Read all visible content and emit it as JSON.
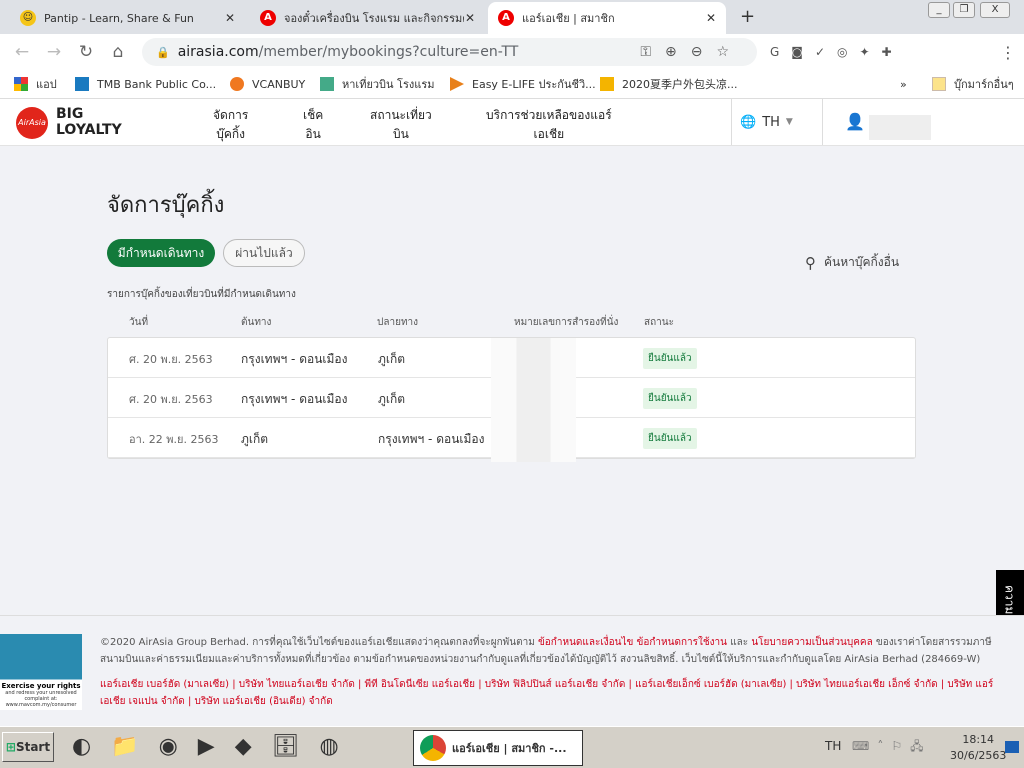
{
  "browser": {
    "tabs": [
      {
        "title": "Pantip - Learn, Share & Fun"
      },
      {
        "title": "จองตั๋วเครื่องบิน โรงแรม และกิจกรรมต่"
      },
      {
        "title": "แอร์เอเชีย | สมาชิก",
        "active": true
      }
    ],
    "url_host": "airasia.com",
    "url_path": "/member/mybookings?culture=en-TT",
    "bookmarks": [
      "แอป",
      "TMB Bank Public Co...",
      "VCANBUY",
      "หาเที่ยวบิน โรงแรม",
      "Easy E-LIFE ประกันชีวิ...",
      "2020夏季户外包头凉...",
      "บุ๊กมาร์กอื่นๆ"
    ]
  },
  "header": {
    "logo_brand": "AirAsia",
    "logo_line1": "BIG",
    "logo_line2": "LOYALTY",
    "menu": [
      [
        "จัดการ",
        "บุ๊คกิ้ง"
      ],
      [
        "เช็ค",
        "อิน"
      ],
      [
        "สถานะเที่ยว",
        "บิน"
      ],
      [
        "บริการช่วยเหลือของแอร์",
        "เอเชีย"
      ]
    ],
    "language": "TH"
  },
  "page": {
    "title": "จัดการบุ๊คกิ้ง",
    "tab_upcoming": "มีกำหนดเดินทาง",
    "tab_past": "ผ่านไปแล้ว",
    "search_other": "ค้นหาบุ๊คกิ้งอื่น",
    "list_caption": "รายการบุ๊คกิ้งของเที่ยวบินที่มีกำหนดเดินทาง",
    "columns": [
      "วันที่",
      "ต้นทาง",
      "ปลายทาง",
      "หมายเลขการสำรองที่นั่ง",
      "สถานะ"
    ],
    "rows": [
      {
        "date": "ศ. 20 พ.ย. 2563",
        "origin": "กรุงเทพฯ - ดอนเมือง",
        "destination": "ภูเก็ต",
        "status": "ยืนยันแล้ว"
      },
      {
        "date": "ศ. 20 พ.ย. 2563",
        "origin": "กรุงเทพฯ - ดอนเมือง",
        "destination": "ภูเก็ต",
        "status": "ยืนยันแล้ว"
      },
      {
        "date": "อา. 22 พ.ย. 2563",
        "origin": "ภูเก็ต",
        "destination": "กรุงเทพฯ - ดอนเมือง",
        "status": "ยืนยันแล้ว"
      }
    ],
    "accent": "#127a3b"
  },
  "feedback": "ความคิดเห็น",
  "footer": {
    "copy1": "©2020 AirAsia Group Berhad. การที่คุณใช้เว็บไซต์ของแอร์เอเชียแสดงว่าคุณตกลงที่จะผูกพันตาม ",
    "link1": "ข้อกำหนดและเงื่อนไข ข้อกำหนดการใช้งาน",
    "and": " และ ",
    "link2": "นโยบายความเป็นส่วนบุคคล",
    "copy2": " ของเราค่าโดยสารรวมภาษีสนามบินและค่าธรรมเนียมและค่าบริการทั้งหมดที่เกี่ยวข้อง ตามข้อกำหนดของหน่วยงานกำกับดูแลที่เกี่ยวข้องได้บัญญัติไว้ สงวนลิขสิทธิ์. เว็บไซต์นี้ให้บริการและกำกับดูแลโดย AirAsia Berhad (284669-W) (\"AirAsia\")",
    "companies": "แอร์เอเชีย เบอร์ฮัด (มาเลเซีย) | บริษัท ไทยแอร์เอเชีย จำกัด | พีที อินโดนีเซีย แอร์เอเชีย | บริษัท ฟิลิปปินส์ แอร์เอเชีย จำกัด | แอร์เอเชียเอ็กซ์ เบอร์ฮัด (มาเลเซีย) | บริษัท ไทยแอร์เอเชีย เอ็กซ์ จำกัด | บริษัท แอร์เอเชีย เจแปน จำกัด | บริษัท แอร์เอเชีย (อินเดีย) จำกัด",
    "badge_title": "Exercise your rights",
    "badge_sub": "and redress your unresolved complaint at: www.mavcom.my/consumer"
  },
  "taskbar": {
    "start": "Start",
    "window": "แอร์เอเชีย | สมาชิก -...",
    "lang": "TH",
    "time": "18:14",
    "date": "30/6/2563"
  }
}
